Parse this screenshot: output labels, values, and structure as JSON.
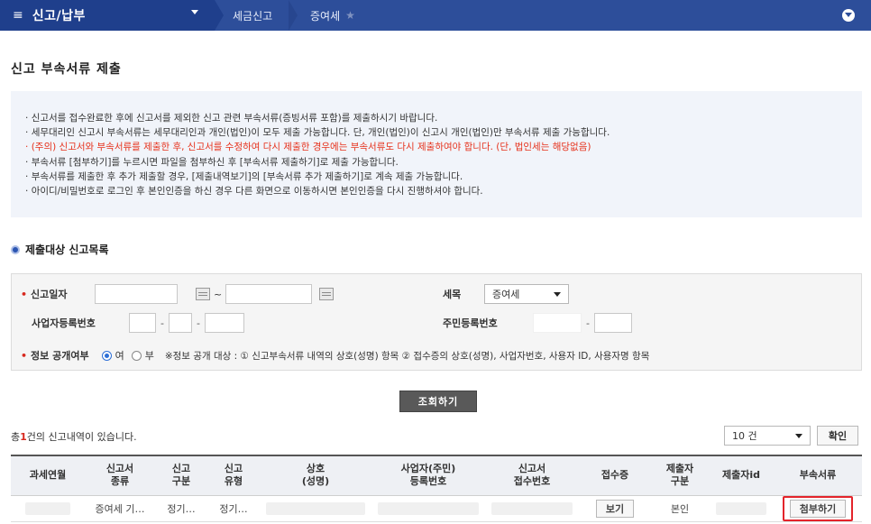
{
  "topnav": {
    "menu_title": "신고/납부",
    "crumb1": "세금신고",
    "crumb2": "증여세"
  },
  "page": {
    "title": "신고 부속서류 제출"
  },
  "notice": {
    "items": [
      "신고서를 접수완료한 후에 신고서를 제외한 신고 관련 부속서류(증빙서류 포함)를 제출하시기 바랍니다.",
      "세무대리인 신고시 부속서류는 세무대리인과 개인(법인)이 모두 제출 가능합니다. 단, 개인(법인)이 신고시 개인(법인)만 부속서류 제출 가능합니다.",
      "(주의) 신고서와 부속서류를 제출한 후, 신고서를 수정하여 다시 제출한 경우에는 부속서류도 다시 제출하여야 합니다. (단, 법인세는 해당없음)",
      "부속서류 [첨부하기]를 누르시면 파일을 첨부하신 후 [부속서류 제출하기]로 제출 가능합니다.",
      "부속서류를 제출한 후 추가 제출할 경우, [제출내역보기]의 [부속서류 추가 제출하기]로 계속 제출 가능합니다.",
      "아이디/비밀번호로 로그인 후 본인인증을 하신 경우 다른 화면으로 이동하시면 본인인증을 다시 진행하셔야 합니다."
    ]
  },
  "section": {
    "title": "제출대상 신고목록"
  },
  "search": {
    "report_date_label": "신고일자",
    "tilde": "~",
    "tax_label": "세목",
    "tax_value": "증여세",
    "biz_no_label": "사업자등록번호",
    "resident_no_label": "주민등록번호",
    "disclosure_label": "정보 공개여부",
    "yes": "여",
    "no": "부",
    "disclosure_note": "※정보 공개 대상 : ① 신고부속서류 내역의 상호(성명) 항목 ② 접수증의 상호(성명), 사업자번호, 사용자 ID, 사용자명 항목",
    "button": "조회하기"
  },
  "results": {
    "count_prefix": "총",
    "count": "1",
    "count_suffix": "건의 신고내역이 있습니다.",
    "page_size": "10 건",
    "confirm": "확인",
    "headers": [
      [
        "과세연월"
      ],
      [
        "신고서",
        "종류"
      ],
      [
        "신고",
        "구분"
      ],
      [
        "신고",
        "유형"
      ],
      [
        "상호",
        "(성명)"
      ],
      [
        "사업자(주민)",
        "등록번호"
      ],
      [
        "신고서",
        "접수번호"
      ],
      [
        "접수증"
      ],
      [
        "제출자",
        "구분"
      ],
      [
        "제출자id"
      ],
      [
        "부속서류"
      ]
    ],
    "row": {
      "kind": "증여세 기…",
      "report_type": "정기…",
      "report_class": "정기…",
      "receipt_btn": "보기",
      "submitter_type": "본인",
      "attach_btn": "첨부하기"
    }
  },
  "colors": {
    "topbar": "#2d4e9a",
    "required": "#d7281e",
    "warning_text": "#e6311b",
    "highlight_box": "#e3242b"
  }
}
